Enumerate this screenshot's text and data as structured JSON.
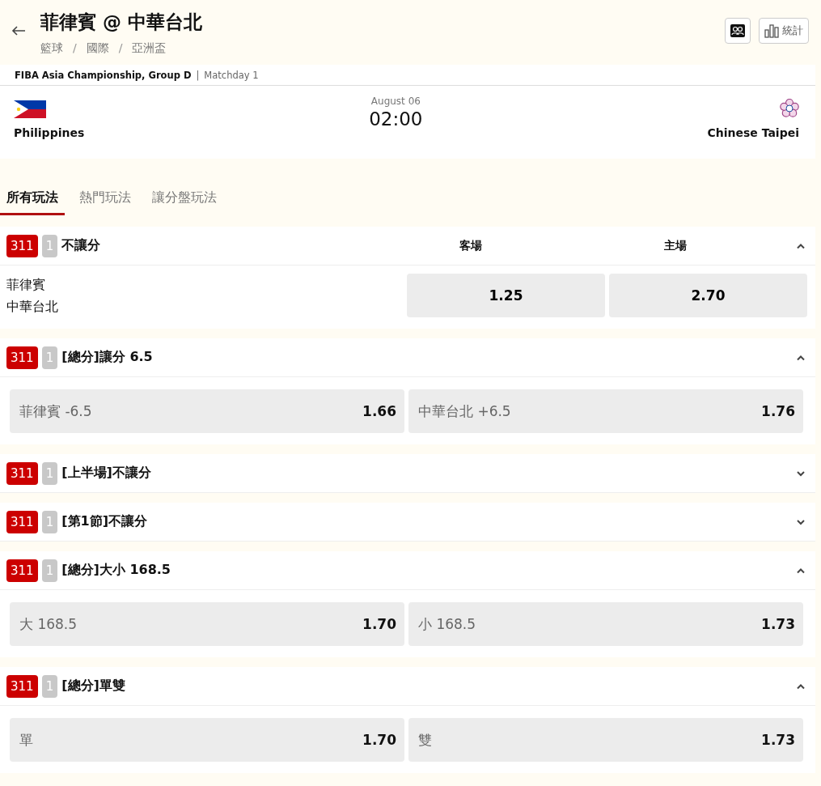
{
  "header": {
    "title": "菲律賓 @ 中華台北",
    "breadcrumbs": [
      "籃球",
      "國際",
      "亞洲盃"
    ],
    "breadcrumb_separator": "/",
    "stats_label": "統計"
  },
  "league": {
    "name": "FIBA Asia Championship, Group D",
    "separator": "|",
    "round": "Matchday 1"
  },
  "match": {
    "home": "Philippines",
    "away": "Chinese Taipei",
    "date": "August 06",
    "time": "02:00"
  },
  "tabs": [
    {
      "label": "所有玩法",
      "selected": true
    },
    {
      "label": "熱門玩法",
      "selected": false
    },
    {
      "label": "讓分盤玩法",
      "selected": false
    }
  ],
  "markets": [
    {
      "kind": "matchup",
      "code": "311",
      "count": "1",
      "title": "不讓分",
      "expanded": true,
      "columns": [
        "客場",
        "主場"
      ],
      "teams": [
        "菲律賓",
        "中華台北"
      ],
      "odds": [
        "1.25",
        "2.70"
      ]
    },
    {
      "kind": "pair",
      "code": "311",
      "count": "1",
      "title": "[總分]讓分 6.5",
      "expanded": true,
      "options": [
        {
          "label": "菲律賓 -6.5",
          "odds": "1.66"
        },
        {
          "label": "中華台北 +6.5",
          "odds": "1.76"
        }
      ]
    },
    {
      "kind": "pair",
      "code": "311",
      "count": "1",
      "title": "[上半場]不讓分",
      "expanded": false
    },
    {
      "kind": "pair",
      "code": "311",
      "count": "1",
      "title": "[第1節]不讓分",
      "expanded": false
    },
    {
      "kind": "pair",
      "code": "311",
      "count": "1",
      "title": "[總分]大小 168.5",
      "expanded": true,
      "options": [
        {
          "label": "大 168.5",
          "odds": "1.70"
        },
        {
          "label": "小 168.5",
          "odds": "1.73"
        }
      ]
    },
    {
      "kind": "pair",
      "code": "311",
      "count": "1",
      "title": "[總分]單雙",
      "expanded": true,
      "options": [
        {
          "label": "單",
          "odds": "1.70"
        },
        {
          "label": "雙",
          "odds": "1.73"
        }
      ]
    }
  ]
}
